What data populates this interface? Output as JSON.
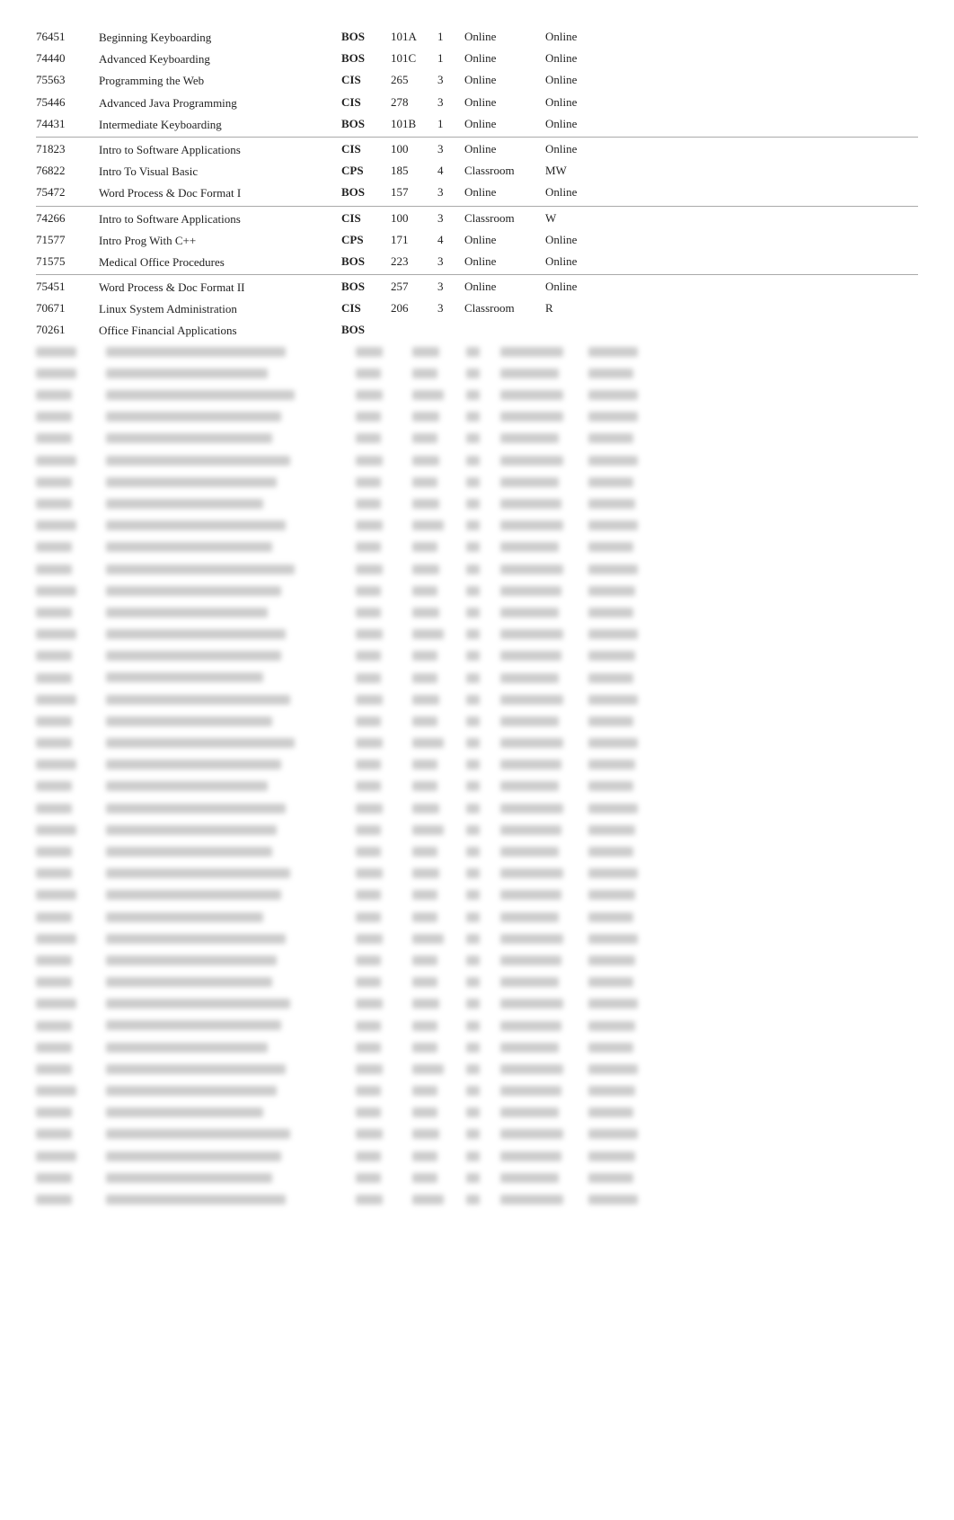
{
  "rows": [
    {
      "id": "76451",
      "name": "Beginning Keyboarding",
      "dept": "BOS",
      "num": "101A",
      "credits": "1",
      "location": "Online",
      "days": "Online",
      "border": false
    },
    {
      "id": "74440",
      "name": "Advanced Keyboarding",
      "dept": "BOS",
      "num": "101C",
      "credits": "1",
      "location": "Online",
      "days": "Online",
      "border": false
    },
    {
      "id": "75563",
      "name": "Programming the Web",
      "dept": "CIS",
      "num": "265",
      "credits": "3",
      "location": "Online",
      "days": "Online",
      "border": false
    },
    {
      "id": "75446",
      "name": "Advanced Java Programming",
      "dept": "CIS",
      "num": "278",
      "credits": "3",
      "location": "Online",
      "days": "Online",
      "border": false
    },
    {
      "id": "74431",
      "name": "Intermediate Keyboarding",
      "dept": "BOS",
      "num": "101B",
      "credits": "1",
      "location": "Online",
      "days": "Online",
      "border": true
    },
    {
      "id": "71823",
      "name": "Intro to Software Applications",
      "dept": "CIS",
      "num": "100",
      "credits": "3",
      "location": "Online",
      "days": "Online",
      "border": false
    },
    {
      "id": "76822",
      "name": "Intro To Visual Basic",
      "dept": "CPS",
      "num": "185",
      "credits": "4",
      "location": "Classroom",
      "days": "MW",
      "border": false
    },
    {
      "id": "75472",
      "name": "Word Process & Doc Format I",
      "dept": "BOS",
      "num": "157",
      "credits": "3",
      "location": "Online",
      "days": "Online",
      "border": true
    },
    {
      "id": "74266",
      "name": "Intro to Software Applications",
      "dept": "CIS",
      "num": "100",
      "credits": "3",
      "location": "Classroom",
      "days": "W",
      "border": false
    },
    {
      "id": "71577",
      "name": "Intro Prog With C++",
      "dept": "CPS",
      "num": "171",
      "credits": "4",
      "location": "Online",
      "days": "Online",
      "border": false
    },
    {
      "id": "71575",
      "name": "Medical Office Procedures",
      "dept": "BOS",
      "num": "223",
      "credits": "3",
      "location": "Online",
      "days": "Online",
      "border": true
    },
    {
      "id": "75451",
      "name": "Word Process & Doc Format II",
      "dept": "BOS",
      "num": "257",
      "credits": "3",
      "location": "Online",
      "days": "Online",
      "border": false
    },
    {
      "id": "70671",
      "name": "Linux System Administration",
      "dept": "CIS",
      "num": "206",
      "credits": "3",
      "location": "Classroom",
      "days": "R",
      "border": false
    },
    {
      "id": "70261",
      "name": "Office Financial Applications",
      "dept": "BOS",
      "num": "",
      "credits": "",
      "location": "",
      "days": "",
      "border": false
    }
  ],
  "blurred_rows": [
    {
      "id_w": 45,
      "name_w": 200,
      "dept_w": 30,
      "num_w": 30,
      "credits_w": 15,
      "loc_w": 70,
      "days_w": 55
    },
    {
      "id_w": 45,
      "name_w": 180,
      "dept_w": 28,
      "num_w": 28,
      "credits_w": 15,
      "loc_w": 65,
      "days_w": 50
    },
    {
      "id_w": 40,
      "name_w": 210,
      "dept_w": 30,
      "num_w": 35,
      "credits_w": 15,
      "loc_w": 70,
      "days_w": 55
    },
    {
      "id_w": 40,
      "name_w": 195,
      "dept_w": 28,
      "num_w": 30,
      "credits_w": 15,
      "loc_w": 70,
      "days_w": 55
    },
    {
      "id_w": 40,
      "name_w": 185,
      "dept_w": 28,
      "num_w": 28,
      "credits_w": 15,
      "loc_w": 65,
      "days_w": 50
    },
    {
      "id_w": 45,
      "name_w": 205,
      "dept_w": 30,
      "num_w": 30,
      "credits_w": 15,
      "loc_w": 70,
      "days_w": 55
    },
    {
      "id_w": 40,
      "name_w": 190,
      "dept_w": 28,
      "num_w": 28,
      "credits_w": 15,
      "loc_w": 65,
      "days_w": 50
    },
    {
      "id_w": 40,
      "name_w": 175,
      "dept_w": 28,
      "num_w": 30,
      "credits_w": 15,
      "loc_w": 68,
      "days_w": 52
    },
    {
      "id_w": 45,
      "name_w": 200,
      "dept_w": 30,
      "num_w": 35,
      "credits_w": 15,
      "loc_w": 70,
      "days_w": 55
    },
    {
      "id_w": 40,
      "name_w": 185,
      "dept_w": 28,
      "num_w": 28,
      "credits_w": 15,
      "loc_w": 65,
      "days_w": 50
    },
    {
      "id_w": 40,
      "name_w": 210,
      "dept_w": 30,
      "num_w": 30,
      "credits_w": 15,
      "loc_w": 70,
      "days_w": 55
    },
    {
      "id_w": 45,
      "name_w": 195,
      "dept_w": 28,
      "num_w": 28,
      "credits_w": 15,
      "loc_w": 68,
      "days_w": 52
    },
    {
      "id_w": 40,
      "name_w": 180,
      "dept_w": 28,
      "num_w": 30,
      "credits_w": 15,
      "loc_w": 65,
      "days_w": 50
    },
    {
      "id_w": 45,
      "name_w": 200,
      "dept_w": 30,
      "num_w": 35,
      "credits_w": 15,
      "loc_w": 70,
      "days_w": 55
    },
    {
      "id_w": 40,
      "name_w": 195,
      "dept_w": 28,
      "num_w": 28,
      "credits_w": 15,
      "loc_w": 68,
      "days_w": 52
    },
    {
      "id_w": 40,
      "name_w": 175,
      "dept_w": 28,
      "num_w": 28,
      "credits_w": 15,
      "loc_w": 65,
      "days_w": 50
    },
    {
      "id_w": 45,
      "name_w": 205,
      "dept_w": 30,
      "num_w": 30,
      "credits_w": 15,
      "loc_w": 70,
      "days_w": 55
    },
    {
      "id_w": 40,
      "name_w": 185,
      "dept_w": 28,
      "num_w": 28,
      "credits_w": 15,
      "loc_w": 65,
      "days_w": 50
    },
    {
      "id_w": 40,
      "name_w": 210,
      "dept_w": 30,
      "num_w": 35,
      "credits_w": 15,
      "loc_w": 70,
      "days_w": 55
    },
    {
      "id_w": 45,
      "name_w": 195,
      "dept_w": 28,
      "num_w": 28,
      "credits_w": 15,
      "loc_w": 68,
      "days_w": 52
    },
    {
      "id_w": 40,
      "name_w": 180,
      "dept_w": 28,
      "num_w": 28,
      "credits_w": 15,
      "loc_w": 65,
      "days_w": 50
    },
    {
      "id_w": 40,
      "name_w": 200,
      "dept_w": 30,
      "num_w": 30,
      "credits_w": 15,
      "loc_w": 70,
      "days_w": 55
    },
    {
      "id_w": 45,
      "name_w": 190,
      "dept_w": 28,
      "num_w": 35,
      "credits_w": 15,
      "loc_w": 68,
      "days_w": 52
    },
    {
      "id_w": 40,
      "name_w": 185,
      "dept_w": 28,
      "num_w": 28,
      "credits_w": 15,
      "loc_w": 65,
      "days_w": 50
    },
    {
      "id_w": 40,
      "name_w": 205,
      "dept_w": 30,
      "num_w": 30,
      "credits_w": 15,
      "loc_w": 70,
      "days_w": 55
    },
    {
      "id_w": 45,
      "name_w": 195,
      "dept_w": 28,
      "num_w": 28,
      "credits_w": 15,
      "loc_w": 68,
      "days_w": 52
    },
    {
      "id_w": 40,
      "name_w": 175,
      "dept_w": 28,
      "num_w": 28,
      "credits_w": 15,
      "loc_w": 65,
      "days_w": 50
    },
    {
      "id_w": 45,
      "name_w": 200,
      "dept_w": 30,
      "num_w": 35,
      "credits_w": 15,
      "loc_w": 70,
      "days_w": 55
    },
    {
      "id_w": 40,
      "name_w": 190,
      "dept_w": 28,
      "num_w": 28,
      "credits_w": 15,
      "loc_w": 68,
      "days_w": 52
    },
    {
      "id_w": 40,
      "name_w": 185,
      "dept_w": 28,
      "num_w": 28,
      "credits_w": 15,
      "loc_w": 65,
      "days_w": 50
    },
    {
      "id_w": 45,
      "name_w": 205,
      "dept_w": 30,
      "num_w": 30,
      "credits_w": 15,
      "loc_w": 70,
      "days_w": 55
    },
    {
      "id_w": 40,
      "name_w": 195,
      "dept_w": 28,
      "num_w": 28,
      "credits_w": 15,
      "loc_w": 68,
      "days_w": 52
    },
    {
      "id_w": 40,
      "name_w": 180,
      "dept_w": 28,
      "num_w": 28,
      "credits_w": 15,
      "loc_w": 65,
      "days_w": 50
    },
    {
      "id_w": 40,
      "name_w": 200,
      "dept_w": 30,
      "num_w": 35,
      "credits_w": 15,
      "loc_w": 70,
      "days_w": 55
    },
    {
      "id_w": 45,
      "name_w": 190,
      "dept_w": 28,
      "num_w": 28,
      "credits_w": 15,
      "loc_w": 68,
      "days_w": 52
    },
    {
      "id_w": 40,
      "name_w": 175,
      "dept_w": 28,
      "num_w": 28,
      "credits_w": 15,
      "loc_w": 65,
      "days_w": 50
    },
    {
      "id_w": 40,
      "name_w": 205,
      "dept_w": 30,
      "num_w": 30,
      "credits_w": 15,
      "loc_w": 70,
      "days_w": 55
    },
    {
      "id_w": 45,
      "name_w": 195,
      "dept_w": 28,
      "num_w": 28,
      "credits_w": 15,
      "loc_w": 68,
      "days_w": 52
    },
    {
      "id_w": 40,
      "name_w": 185,
      "dept_w": 28,
      "num_w": 28,
      "credits_w": 15,
      "loc_w": 65,
      "days_w": 50
    },
    {
      "id_w": 40,
      "name_w": 200,
      "dept_w": 30,
      "num_w": 35,
      "credits_w": 15,
      "loc_w": 70,
      "days_w": 55
    }
  ]
}
